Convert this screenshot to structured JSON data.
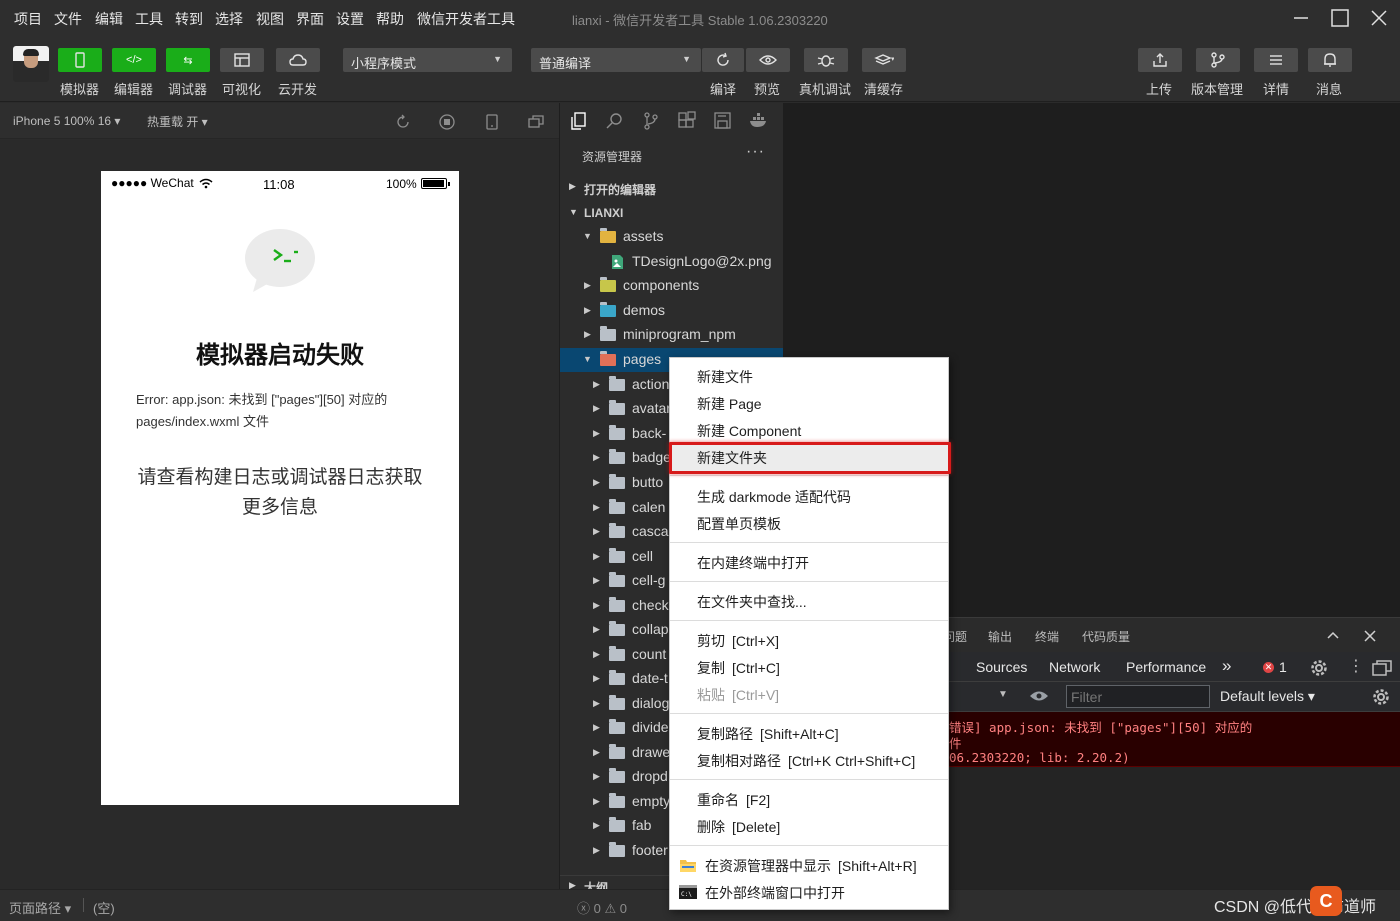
{
  "menubar": {
    "items": [
      "项目",
      "文件",
      "编辑",
      "工具",
      "转到",
      "选择",
      "视图",
      "界面",
      "设置",
      "帮助",
      "微信开发者工具"
    ],
    "title": "lianxi - 微信开发者工具 Stable 1.06.2303220"
  },
  "toolbar": {
    "mode_buttons": [
      {
        "label": "模拟器",
        "icon": "phone-icon"
      },
      {
        "label": "编辑器",
        "icon": "code-icon"
      },
      {
        "label": "调试器",
        "icon": "debug-icon"
      },
      {
        "label": "可视化",
        "icon": "layout-icon"
      },
      {
        "label": "云开发",
        "icon": "cloud-icon"
      }
    ],
    "mode_select": "小程序模式",
    "compile_select": "普通编译",
    "actions": [
      {
        "label": "编译",
        "icon": "refresh-icon"
      },
      {
        "label": "预览",
        "icon": "eye-icon"
      },
      {
        "label": "真机调试",
        "icon": "bug-icon"
      },
      {
        "label": "清缓存",
        "icon": "layers-icon"
      }
    ],
    "right_actions": [
      {
        "label": "上传",
        "icon": "upload-icon"
      },
      {
        "label": "版本管理",
        "icon": "branch-icon"
      },
      {
        "label": "详情",
        "icon": "menu-icon"
      },
      {
        "label": "消息",
        "icon": "bell-icon"
      }
    ]
  },
  "simulator": {
    "device": "iPhone 5 100% 16",
    "hot_reload": "热重载 开",
    "status_left": "●●●●● WeChat",
    "status_time": "11:08",
    "status_battery": "100%",
    "error_title": "模拟器启动失败",
    "error_message": "Error: app.json: 未找到 [\"pages\"][50] 对应的 pages/index.wxml 文件",
    "error_hint": "请查看构建日志或调试器日志获取更多信息"
  },
  "explorer": {
    "title": "资源管理器",
    "more": "···",
    "open_editors": "打开的编辑器",
    "project": "LIANXI",
    "tree": [
      {
        "name": "assets",
        "level": 1,
        "expanded": true
      },
      {
        "name": "TDesignLogo@2x.png",
        "level": 2,
        "file": true
      },
      {
        "name": "components",
        "level": 1
      },
      {
        "name": "demos",
        "level": 1
      },
      {
        "name": "miniprogram_npm",
        "level": 1
      },
      {
        "name": "pages",
        "level": 1,
        "expanded": true,
        "selected": true
      },
      {
        "name": "action",
        "level": 2
      },
      {
        "name": "avatar",
        "level": 2
      },
      {
        "name": "back-",
        "level": 2
      },
      {
        "name": "badge",
        "level": 2
      },
      {
        "name": "butto",
        "level": 2
      },
      {
        "name": "calen",
        "level": 2
      },
      {
        "name": "casca",
        "level": 2
      },
      {
        "name": "cell",
        "level": 2
      },
      {
        "name": "cell-g",
        "level": 2
      },
      {
        "name": "check",
        "level": 2
      },
      {
        "name": "collap",
        "level": 2
      },
      {
        "name": "count",
        "level": 2
      },
      {
        "name": "date-t",
        "level": 2
      },
      {
        "name": "dialog",
        "level": 2
      },
      {
        "name": "divide",
        "level": 2
      },
      {
        "name": "drawe",
        "level": 2
      },
      {
        "name": "dropd",
        "level": 2
      },
      {
        "name": "empty",
        "level": 2
      },
      {
        "name": "fab",
        "level": 2
      },
      {
        "name": "footer",
        "level": 2
      }
    ],
    "outline": "大纲",
    "problems": "ⓧ 0 ⚠ 0"
  },
  "context_menu": {
    "items": [
      {
        "label": "新建文件"
      },
      {
        "label": "新建 Page"
      },
      {
        "label": "新建 Component"
      },
      {
        "label": "新建文件夹",
        "highlighted": true
      },
      {
        "sep": true
      },
      {
        "label": "生成 darkmode 适配代码"
      },
      {
        "label": "配置单页模板"
      },
      {
        "sep": true
      },
      {
        "label": "在内建终端中打开"
      },
      {
        "sep": true
      },
      {
        "label": "在文件夹中查找..."
      },
      {
        "sep": true
      },
      {
        "label": "剪切",
        "shortcut": "[Ctrl+X]"
      },
      {
        "label": "复制",
        "shortcut": "[Ctrl+C]"
      },
      {
        "label": "粘贴",
        "shortcut": "[Ctrl+V]",
        "disabled": true
      },
      {
        "sep": true
      },
      {
        "label": "复制路径",
        "shortcut": "[Shift+Alt+C]"
      },
      {
        "label": "复制相对路径",
        "shortcut": "[Ctrl+K Ctrl+Shift+C]"
      },
      {
        "sep": true
      },
      {
        "label": "重命名",
        "shortcut": "[F2]"
      },
      {
        "label": "删除",
        "shortcut": "[Delete]"
      },
      {
        "sep": true
      },
      {
        "label": "在资源管理器中显示",
        "shortcut": "[Shift+Alt+R]",
        "icon": "explorer-icon"
      },
      {
        "label": "在外部终端窗口中打开",
        "icon": "terminal-icon"
      }
    ]
  },
  "devtools": {
    "panel_tabs": [
      "问题",
      "输出",
      "终端",
      "代码质量"
    ],
    "tabs": [
      "Sources",
      "Network",
      "Performance"
    ],
    "more": "»",
    "error_count": "1",
    "filter_placeholder": "Filter",
    "levels": "Default levels",
    "log_lines": [
      "错误] app.json: 未找到 [\"pages\"][50] 对应的",
      "件",
      "06.2303220; lib: 2.20.2)"
    ]
  },
  "bottom": {
    "page_path": "页面路径",
    "empty": "(空)",
    "watermark": "CSDN @低代码布道师"
  },
  "colors": {
    "accent": "#1aad19",
    "highlight": "#d71a1a",
    "selection": "#094771"
  }
}
